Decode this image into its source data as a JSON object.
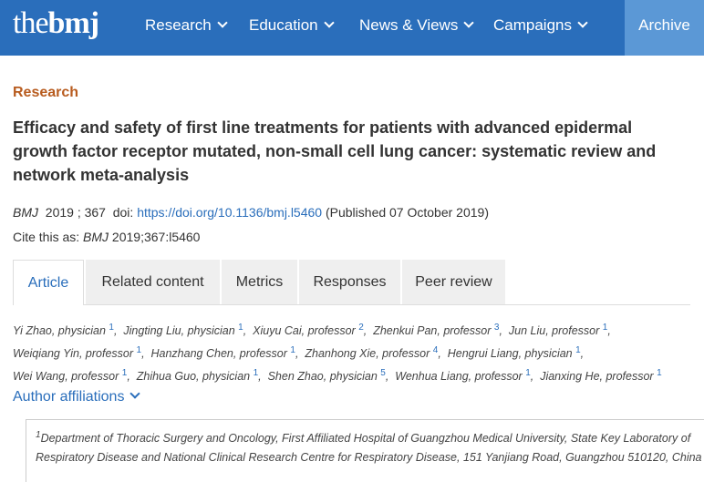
{
  "nav": {
    "logo_the": "the",
    "logo_bmj": "bmj",
    "items": [
      "Research",
      "Education",
      "News & Views",
      "Campaigns"
    ],
    "archive": "Archive"
  },
  "article": {
    "section": "Research",
    "title": "Efficacy and safety of first line treatments for patients with advanced epidermal growth factor receptor mutated, non-small cell lung cancer: systematic review and network meta-analysis",
    "journal": "BMJ",
    "year_vol": "2019 ; 367",
    "doi_label": "doi:",
    "doi": "https://doi.org/10.1136/bmj.l5460",
    "published": "(Published 07 October 2019)",
    "cite_label": "Cite this as:",
    "cite_journal": "BMJ",
    "cite_ref": "2019;367:l5460"
  },
  "tabs": [
    "Article",
    "Related content",
    "Metrics",
    "Responses",
    "Peer review"
  ],
  "authors": [
    {
      "name": "Yi Zhao, physician",
      "sup": "1"
    },
    {
      "name": "Jingting Liu, physician",
      "sup": "1"
    },
    {
      "name": "Xiuyu Cai, professor",
      "sup": "2"
    },
    {
      "name": "Zhenkui Pan, professor",
      "sup": "3"
    },
    {
      "name": "Jun Liu, professor",
      "sup": "1"
    },
    {
      "name": "Weiqiang Yin, professor",
      "sup": "1"
    },
    {
      "name": "Hanzhang Chen, professor",
      "sup": "1"
    },
    {
      "name": "Zhanhong Xie, professor",
      "sup": "4"
    },
    {
      "name": "Hengrui Liang, physician",
      "sup": "1"
    },
    {
      "name": "Wei Wang, professor",
      "sup": "1"
    },
    {
      "name": "Zhihua Guo, physician",
      "sup": "1"
    },
    {
      "name": "Shen Zhao, physician",
      "sup": "5"
    },
    {
      "name": "Wenhua Liang, professor",
      "sup": "1"
    },
    {
      "name": "Jianxing He, professor",
      "sup": "1"
    }
  ],
  "affiliations": {
    "toggle": "Author affiliations",
    "first_sup": "1",
    "first_text": "Department of Thoracic Surgery and Oncology, First Affiliated Hospital of Guangzhou Medical University, State Key Laboratory of Respiratory Disease and National Clinical Research Centre for Respiratory Disease, 151 Yanjiang Road, Guangzhou 510120, China"
  },
  "colors": {
    "brand_blue": "#2a6ebb",
    "archive_blue": "#5b98d6",
    "section_orange": "#b85c1f"
  }
}
